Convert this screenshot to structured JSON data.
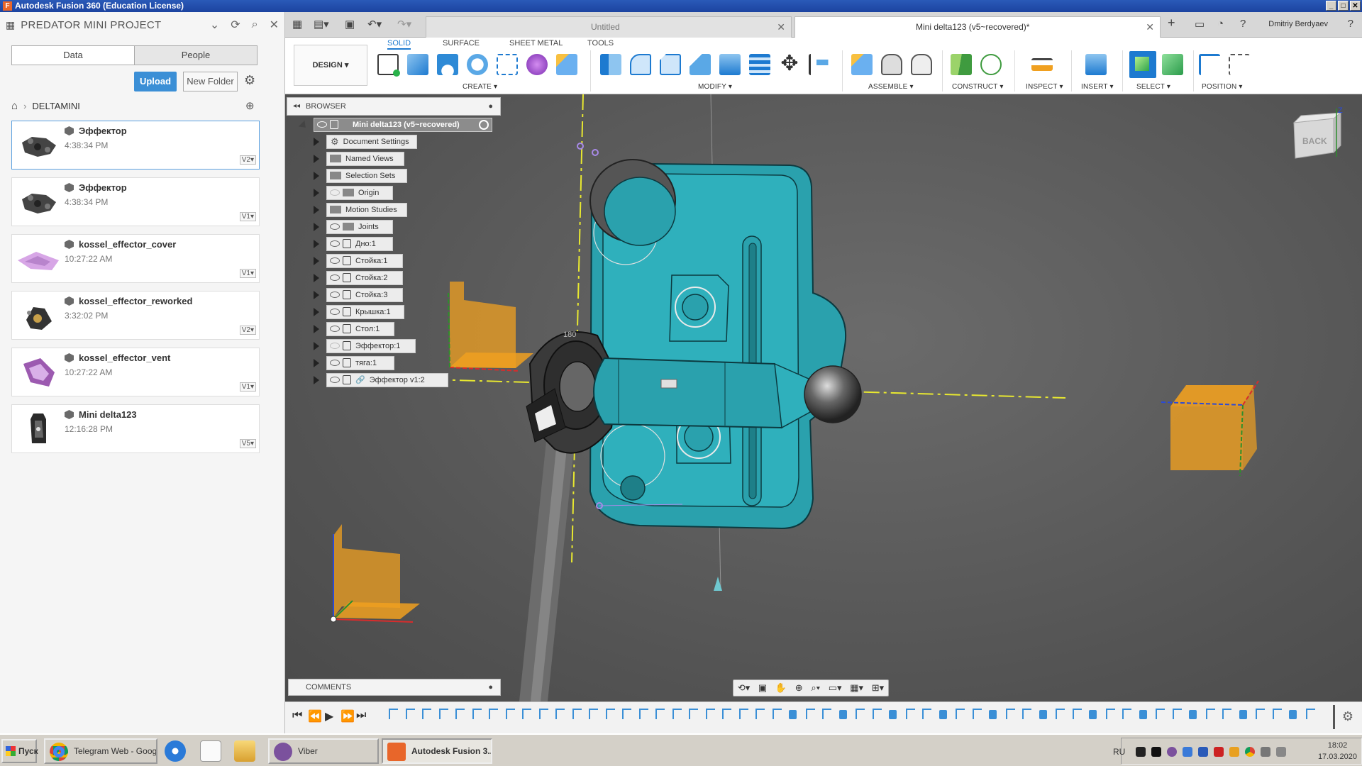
{
  "app": {
    "title": "Autodesk Fusion 360 (Education License)"
  },
  "data_panel": {
    "project": "PREDATOR MINI PROJECT",
    "tabs": {
      "data": "Data",
      "people": "People"
    },
    "upload_label": "Upload",
    "new_folder_label": "New Folder",
    "breadcrumb": "DELTAMINI",
    "files": [
      {
        "name": "Эффектор",
        "time": "4:38:34 PM",
        "version": "V2▾"
      },
      {
        "name": "Эффектор",
        "time": "4:38:34 PM",
        "version": "V1▾"
      },
      {
        "name": "kossel_effector_cover",
        "time": "10:27:22 AM",
        "version": "V1▾"
      },
      {
        "name": "kossel_effector_reworked",
        "time": "3:32:02 PM",
        "version": "V2▾"
      },
      {
        "name": "kossel_effector_vent",
        "time": "10:27:22 AM",
        "version": "V1▾"
      },
      {
        "name": "Mini delta123",
        "time": "12:16:28 PM",
        "version": "V5▾"
      }
    ]
  },
  "tabs": {
    "untitled": "Untitled",
    "active": "Mini delta123 (v5~recovered)*",
    "user": "Dmitriy Berdyaev"
  },
  "toolbar": {
    "design": "DESIGN ▾",
    "tabs": [
      "SOLID",
      "SURFACE",
      "SHEET METAL",
      "TOOLS"
    ],
    "groups": {
      "create": "CREATE ▾",
      "modify": "MODIFY ▾",
      "assemble": "ASSEMBLE ▾",
      "construct": "CONSTRUCT ▾",
      "inspect": "INSPECT ▾",
      "insert": "INSERT ▾",
      "select": "SELECT ▾",
      "position": "POSITION ▾"
    }
  },
  "browser": {
    "title": "BROWSER",
    "root": "Mini delta123 (v5~recovered)",
    "nodes": [
      "Document Settings",
      "Named Views",
      "Selection Sets",
      "Origin",
      "Motion Studies",
      "Joints",
      "Дно:1",
      "Стойка:1",
      "Стойка:2",
      "Стойка:3",
      "Крышка:1",
      "Стол:1",
      "Эффектор:1",
      "тяга:1",
      "Эффектор v1:2"
    ]
  },
  "viewport": {
    "viewcube_face": "BACK",
    "axis_z": "Z",
    "angle_label": "180"
  },
  "comments": {
    "title": "COMMENTS"
  },
  "taskbar": {
    "start": "Пуск",
    "items": [
      "Telegram Web - Goog...",
      "Viber",
      "Autodesk Fusion 3..."
    ],
    "lang": "RU",
    "time": "18:02",
    "date": "17.03.2020"
  },
  "colors": {
    "part": "#2aa1ad",
    "plane": "#f0a020",
    "accent": "#1d7ad0",
    "viewport_bg": "#5b5b5b"
  }
}
